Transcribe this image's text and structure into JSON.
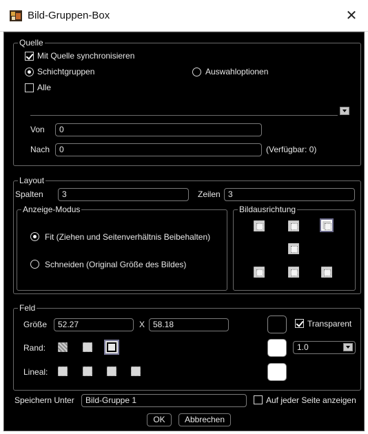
{
  "window": {
    "title": "Bild-Gruppen-Box",
    "close_glyph": "✕"
  },
  "quelle": {
    "title": "Quelle",
    "sync_label": "Mit Quelle synchronisieren",
    "sync_checked": true,
    "radio_schicht": "Schichtgruppen",
    "radio_auswahl": "Auswahloptionen",
    "radio_selected": "Schichtgruppen",
    "alle_label": "Alle",
    "alle_checked": false,
    "source_select_value": "",
    "von_label": "Von",
    "von_value": "0",
    "nach_label": "Nach",
    "nach_value": "0",
    "verfuegbar": "(Verfügbar: 0)"
  },
  "layout": {
    "title": "Layout",
    "spalten_label": "Spalten",
    "spalten_value": "3",
    "zeilen_label": "Zeilen",
    "zeilen_value": "3",
    "anzeige_title": "Anzeige-Modus",
    "fit_label": "Fit (Ziehen und Seitenverhältnis Beibehalten)",
    "schneiden_label": "Schneiden (Original Größe des Bildes)",
    "mode_selected": "Fit",
    "bildausrichtung_title": "Bildausrichtung",
    "alignment_selected": "top-right"
  },
  "feld": {
    "title": "Feld",
    "groesse_label": "Größe",
    "width_value": "52.27",
    "x_label": "X",
    "height_value": "58.18",
    "transparent_label": "Transparent",
    "transparent_checked": true,
    "rand_label": "Rand:",
    "rand_selected": "full-frame",
    "lineal_label": "Lineal:",
    "line_width_value": "1.0",
    "colors": {
      "fill": "#000000",
      "border": "#ffffff",
      "ruler": "#ffffff"
    }
  },
  "footer": {
    "speichern_label": "Speichern Unter",
    "speichern_value": "Bild-Gruppe 1",
    "jede_seite_label": "Auf jeder Seite anzeigen",
    "jede_seite_checked": false,
    "ok_label": "OK",
    "cancel_label": "Abbrechen"
  }
}
